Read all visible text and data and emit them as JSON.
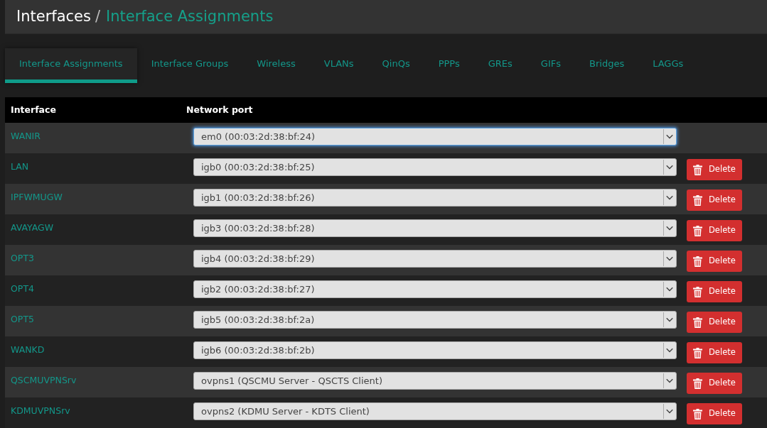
{
  "breadcrumb": {
    "parent": "Interfaces",
    "separator": "/",
    "current": "Interface Assignments"
  },
  "tabs": [
    {
      "label": "Interface Assignments",
      "selected": true
    },
    {
      "label": "Interface Groups",
      "selected": false
    },
    {
      "label": "Wireless",
      "selected": false
    },
    {
      "label": "VLANs",
      "selected": false
    },
    {
      "label": "QinQs",
      "selected": false
    },
    {
      "label": "PPPs",
      "selected": false
    },
    {
      "label": "GREs",
      "selected": false
    },
    {
      "label": "GIFs",
      "selected": false
    },
    {
      "label": "Bridges",
      "selected": false
    },
    {
      "label": "LAGGs",
      "selected": false
    }
  ],
  "table": {
    "columns": [
      "Interface",
      "Network port"
    ],
    "rows": [
      {
        "interface": "WANIR",
        "port": "em0 (00:03:2d:38:bf:24)",
        "focused": true
      },
      {
        "interface": "LAN",
        "port": "igb0 (00:03:2d:38:bf:25)",
        "focused": false,
        "action": "Delete"
      },
      {
        "interface": "IPFWMUGW",
        "port": "igb1 (00:03:2d:38:bf:26)",
        "focused": false,
        "action": "Delete"
      },
      {
        "interface": "AVAYAGW",
        "port": "igb3 (00:03:2d:38:bf:28)",
        "focused": false,
        "action": "Delete"
      },
      {
        "interface": "OPT3",
        "port": "igb4 (00:03:2d:38:bf:29)",
        "focused": false,
        "action": "Delete"
      },
      {
        "interface": "OPT4",
        "port": "igb2 (00:03:2d:38:bf:27)",
        "focused": false,
        "action": "Delete"
      },
      {
        "interface": "OPT5",
        "port": "igb5 (00:03:2d:38:bf:2a)",
        "focused": false,
        "action": "Delete"
      },
      {
        "interface": "WANKD",
        "port": "igb6 (00:03:2d:38:bf:2b)",
        "focused": false,
        "action": "Delete"
      },
      {
        "interface": "QSCMUVPNSrv",
        "port": "ovpns1 (QSCMU Server - QSCTS Client)",
        "focused": false,
        "action": "Delete"
      },
      {
        "interface": "KDMUVPNSrv",
        "port": "ovpns2 (KDMU Server - KDTS Client)",
        "focused": false,
        "action": "Delete"
      }
    ]
  }
}
